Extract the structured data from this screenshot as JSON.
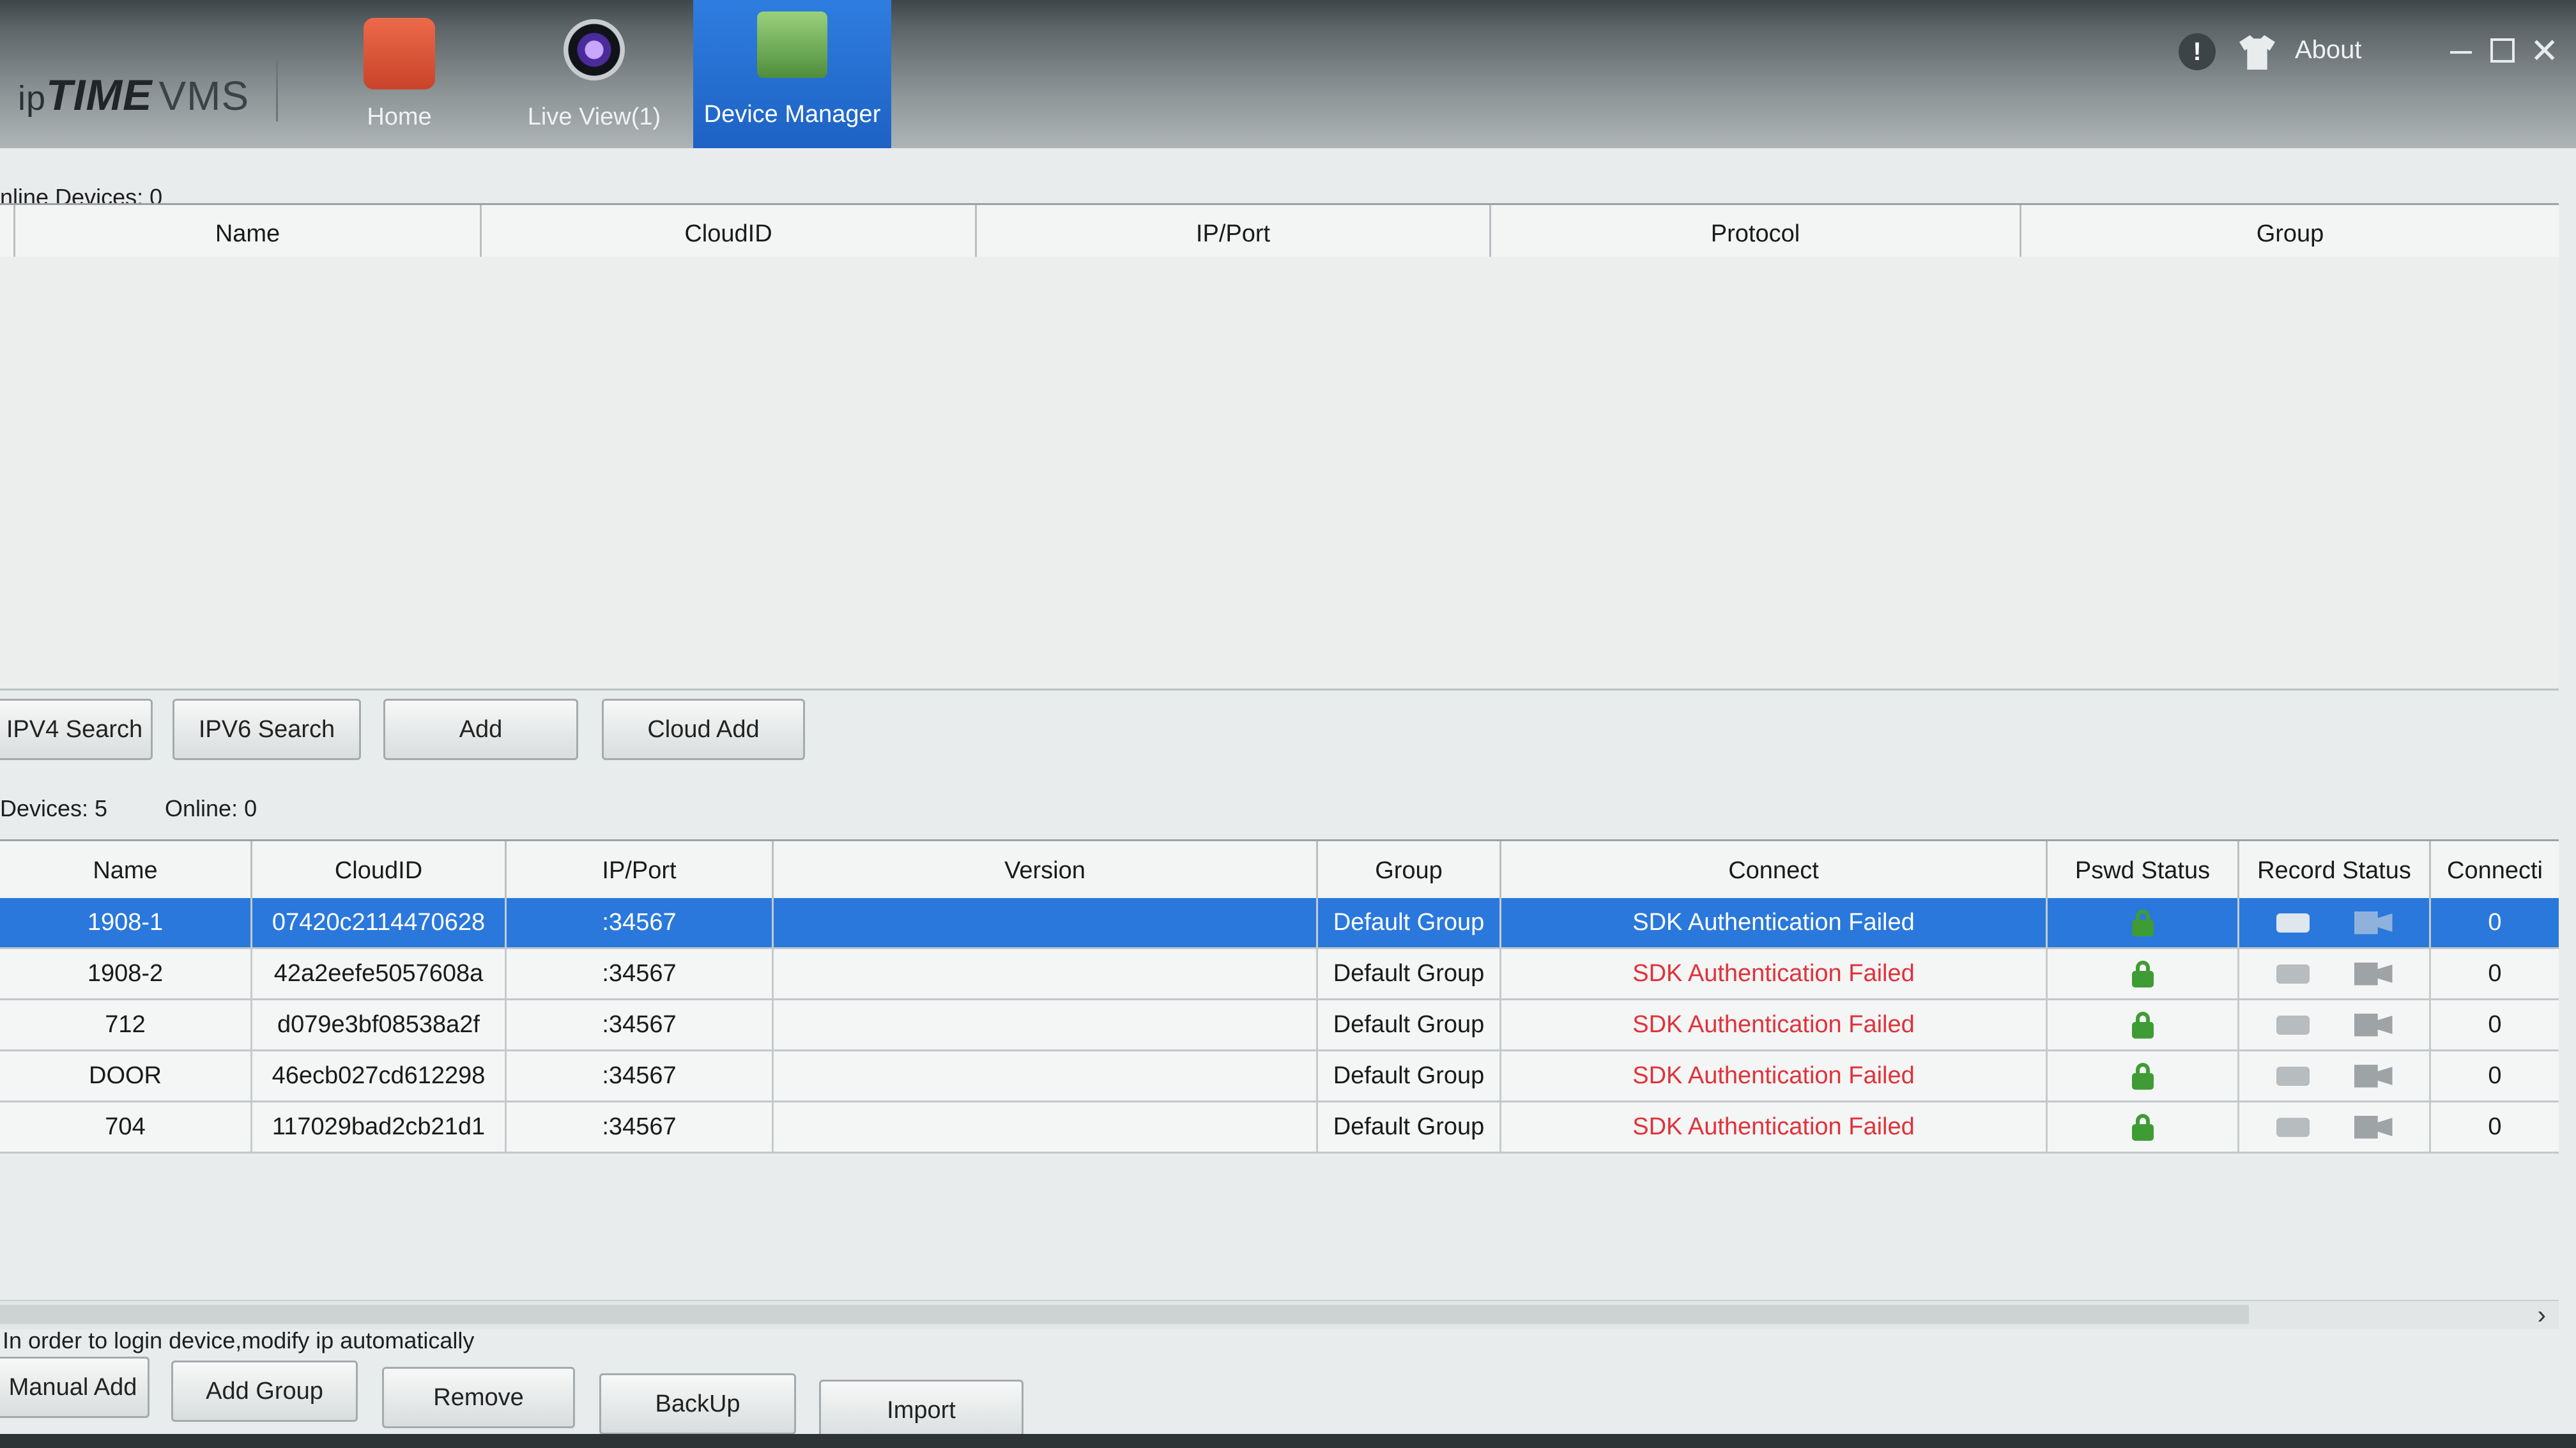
{
  "app": {
    "logo_ip": "ip",
    "logo_time": "TIME",
    "logo_vms": "VMS"
  },
  "nav": {
    "home": "Home",
    "live_view": "Live View(1)",
    "device_manager": "Device Manager"
  },
  "topright": {
    "alert": "!",
    "about": "About"
  },
  "online_panel": {
    "count_label": "nline Devices:  0",
    "columns": [
      "Name",
      "CloudID",
      "IP/Port",
      "Protocol",
      "Group"
    ]
  },
  "search_buttons": {
    "ipv4": "IPV4 Search",
    "ipv6": "IPV6 Search",
    "add": "Add",
    "cloud_add": "Cloud Add"
  },
  "device_panel": {
    "devices_label": "Devices:  5",
    "online_label": "Online:  0",
    "columns": [
      "Name",
      "CloudID",
      "IP/Port",
      "Version",
      "Group",
      "Connect",
      "Pswd Status",
      "Record Status",
      "Connecti"
    ],
    "rows": [
      {
        "name": "1908-1",
        "cloudid": "07420c2114470628",
        "ipport": ":34567",
        "version": "",
        "group": "Default Group",
        "connect": "SDK Authentication Failed",
        "count": "0"
      },
      {
        "name": "1908-2",
        "cloudid": "42a2eefe5057608a",
        "ipport": ":34567",
        "version": "",
        "group": "Default Group",
        "connect": "SDK Authentication Failed",
        "count": "0"
      },
      {
        "name": "712",
        "cloudid": "d079e3bf08538a2f",
        "ipport": ":34567",
        "version": "",
        "group": "Default Group",
        "connect": "SDK Authentication Failed",
        "count": "0"
      },
      {
        "name": "DOOR",
        "cloudid": "46ecb027cd612298",
        "ipport": ":34567",
        "version": "",
        "group": "Default Group",
        "connect": "SDK Authentication Failed",
        "count": "0"
      },
      {
        "name": "704",
        "cloudid": "117029bad2cb21d1",
        "ipport": ":34567",
        "version": "",
        "group": "Default Group",
        "connect": "SDK Authentication Failed",
        "count": "0"
      }
    ]
  },
  "hint": "In order to login device,modify ip automatically",
  "bottom_buttons": {
    "manual_add": "Manual Add",
    "add_group": "Add Group",
    "remove": "Remove",
    "backup": "BackUp",
    "import": "Import"
  },
  "colors": {
    "selection": "#2a78dc",
    "error_text": "#e0323a",
    "lock": "#3f9c35"
  }
}
